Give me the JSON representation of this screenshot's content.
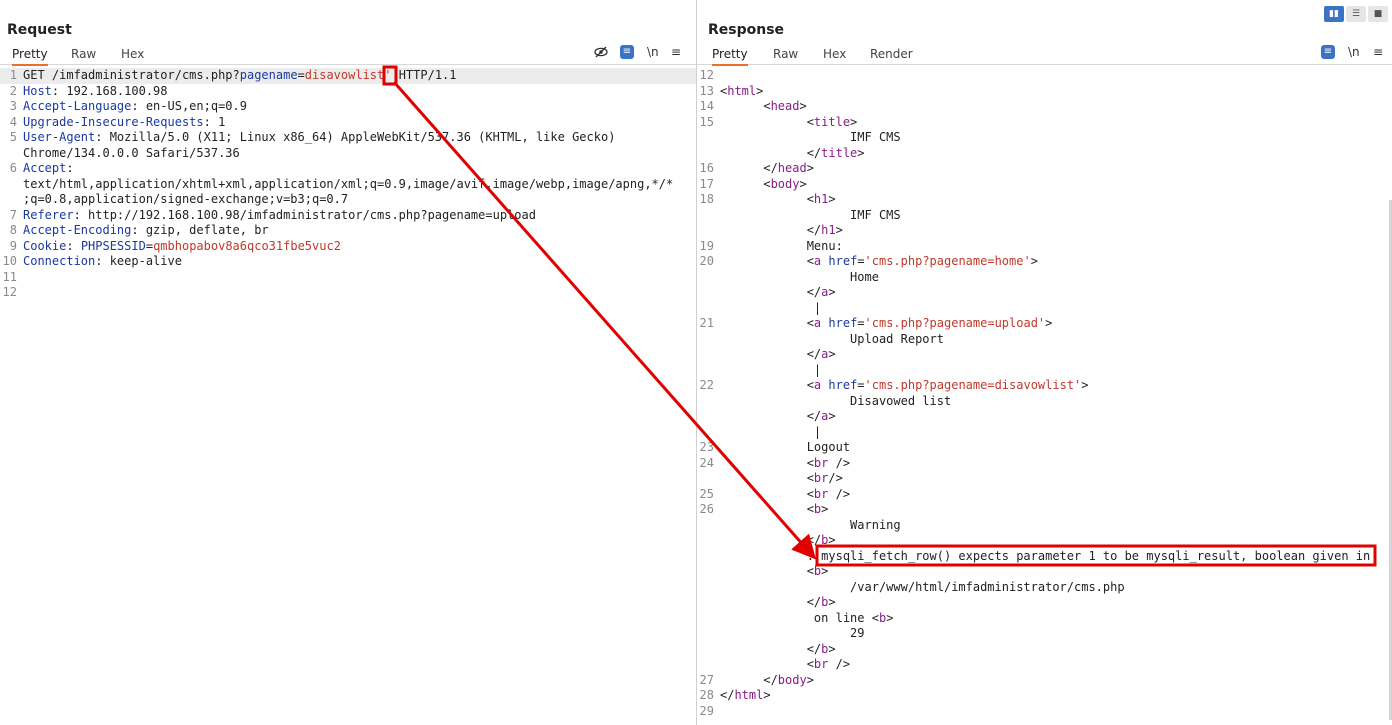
{
  "request": {
    "title": "Request",
    "tabs": [
      "Pretty",
      "Raw",
      "Hex"
    ],
    "tools": {
      "hide_icon": "eye-off-icon",
      "newline_label": "\\n",
      "menu_label": "≡"
    },
    "lines": [
      {
        "n": "1",
        "parts": [
          [
            "t",
            "GET /imfadministrator/cms.php?"
          ],
          [
            "k",
            "pagename"
          ],
          [
            "t",
            "="
          ],
          [
            "v",
            "disavowlist'"
          ],
          [
            "t",
            " HTTP/1.1"
          ]
        ],
        "hl": true
      },
      {
        "n": "2",
        "parts": [
          [
            "k",
            "Host"
          ],
          [
            "t",
            ": 192.168.100.98"
          ]
        ]
      },
      {
        "n": "3",
        "parts": [
          [
            "k",
            "Accept-Language"
          ],
          [
            "t",
            ": en-US,en;q=0.9"
          ]
        ]
      },
      {
        "n": "4",
        "parts": [
          [
            "k",
            "Upgrade-Insecure-Requests"
          ],
          [
            "t",
            ": 1"
          ]
        ]
      },
      {
        "n": "5",
        "parts": [
          [
            "k",
            "User-Agent"
          ],
          [
            "t",
            ": Mozilla/5.0 (X11; Linux x86_64) AppleWebKit/537.36 (KHTML, like Gecko)"
          ]
        ]
      },
      {
        "n": "",
        "parts": [
          [
            "t",
            "Chrome/134.0.0.0 Safari/537.36"
          ]
        ]
      },
      {
        "n": "6",
        "parts": [
          [
            "k",
            "Accept"
          ],
          [
            "t",
            ":"
          ]
        ]
      },
      {
        "n": "",
        "parts": [
          [
            "t",
            "text/html,application/xhtml+xml,application/xml;q=0.9,image/avif,image/webp,image/apng,*/*"
          ]
        ]
      },
      {
        "n": "",
        "parts": [
          [
            "t",
            ";q=0.8,application/signed-exchange;v=b3;q=0.7"
          ]
        ]
      },
      {
        "n": "7",
        "parts": [
          [
            "k",
            "Referer"
          ],
          [
            "t",
            ": http://192.168.100.98/imfadministrator/cms.php?pagename=upload"
          ]
        ]
      },
      {
        "n": "8",
        "parts": [
          [
            "k",
            "Accept-Encoding"
          ],
          [
            "t",
            ": gzip, deflate, br"
          ]
        ]
      },
      {
        "n": "9",
        "parts": [
          [
            "k",
            "Cookie"
          ],
          [
            "t",
            ": "
          ],
          [
            "k",
            "PHPSESSID"
          ],
          [
            "t",
            "="
          ],
          [
            "v",
            "qmbhopabov8a6qco31fbe5vuc2"
          ]
        ]
      },
      {
        "n": "10",
        "parts": [
          [
            "k",
            "Connection"
          ],
          [
            "t",
            ": keep-alive"
          ]
        ]
      },
      {
        "n": "11",
        "parts": []
      },
      {
        "n": "12",
        "parts": []
      }
    ]
  },
  "response": {
    "title": "Response",
    "tabs": [
      "Pretty",
      "Raw",
      "Hex",
      "Render"
    ],
    "tools": {
      "newline_label": "\\n",
      "menu_label": "≡"
    },
    "layout_icons": [
      "split-columns-icon",
      "split-rows-icon",
      "single-panel-icon"
    ],
    "lines": [
      {
        "n": "12",
        "parts": []
      },
      {
        "n": "13",
        "parts": [
          [
            "t",
            "<"
          ],
          [
            "tg",
            "html"
          ],
          [
            "t",
            ">"
          ]
        ]
      },
      {
        "n": "14",
        "parts": [
          [
            "t",
            "      <"
          ],
          [
            "tg",
            "head"
          ],
          [
            "t",
            ">"
          ]
        ]
      },
      {
        "n": "15",
        "parts": [
          [
            "t",
            "            <"
          ],
          [
            "tg",
            "title"
          ],
          [
            "t",
            ">"
          ]
        ]
      },
      {
        "n": "",
        "parts": [
          [
            "t",
            "                  IMF CMS"
          ]
        ]
      },
      {
        "n": "",
        "parts": [
          [
            "t",
            "            </"
          ],
          [
            "tg",
            "title"
          ],
          [
            "t",
            ">"
          ]
        ]
      },
      {
        "n": "16",
        "parts": [
          [
            "t",
            "      </"
          ],
          [
            "tg",
            "head"
          ],
          [
            "t",
            ">"
          ]
        ]
      },
      {
        "n": "17",
        "parts": [
          [
            "t",
            "      <"
          ],
          [
            "tg",
            "body"
          ],
          [
            "t",
            ">"
          ]
        ]
      },
      {
        "n": "18",
        "parts": [
          [
            "t",
            "            <"
          ],
          [
            "tg",
            "h1"
          ],
          [
            "t",
            ">"
          ]
        ]
      },
      {
        "n": "",
        "parts": [
          [
            "t",
            "                  IMF CMS"
          ]
        ]
      },
      {
        "n": "",
        "parts": [
          [
            "t",
            "            </"
          ],
          [
            "tg",
            "h1"
          ],
          [
            "t",
            ">"
          ]
        ]
      },
      {
        "n": "19",
        "parts": [
          [
            "t",
            "            Menu:"
          ]
        ]
      },
      {
        "n": "20",
        "parts": [
          [
            "t",
            "            <"
          ],
          [
            "tg",
            "a"
          ],
          [
            "t",
            " "
          ],
          [
            "at",
            "href"
          ],
          [
            "t",
            "="
          ],
          [
            "s",
            "'cms.php?pagename=home'"
          ],
          [
            "t",
            ">"
          ]
        ]
      },
      {
        "n": "",
        "parts": [
          [
            "t",
            "                  Home"
          ]
        ]
      },
      {
        "n": "",
        "parts": [
          [
            "t",
            "            </"
          ],
          [
            "tg",
            "a"
          ],
          [
            "t",
            ">"
          ]
        ]
      },
      {
        "n": "",
        "parts": [
          [
            "t",
            "             |"
          ]
        ]
      },
      {
        "n": "21",
        "parts": [
          [
            "t",
            "            <"
          ],
          [
            "tg",
            "a"
          ],
          [
            "t",
            " "
          ],
          [
            "at",
            "href"
          ],
          [
            "t",
            "="
          ],
          [
            "s",
            "'cms.php?pagename=upload'"
          ],
          [
            "t",
            ">"
          ]
        ]
      },
      {
        "n": "",
        "parts": [
          [
            "t",
            "                  Upload Report"
          ]
        ]
      },
      {
        "n": "",
        "parts": [
          [
            "t",
            "            </"
          ],
          [
            "tg",
            "a"
          ],
          [
            "t",
            ">"
          ]
        ]
      },
      {
        "n": "",
        "parts": [
          [
            "t",
            "             |"
          ]
        ]
      },
      {
        "n": "22",
        "parts": [
          [
            "t",
            "            <"
          ],
          [
            "tg",
            "a"
          ],
          [
            "t",
            " "
          ],
          [
            "at",
            "href"
          ],
          [
            "t",
            "="
          ],
          [
            "s",
            "'cms.php?pagename=disavowlist'"
          ],
          [
            "t",
            ">"
          ]
        ]
      },
      {
        "n": "",
        "parts": [
          [
            "t",
            "                  Disavowed list"
          ]
        ]
      },
      {
        "n": "",
        "parts": [
          [
            "t",
            "            </"
          ],
          [
            "tg",
            "a"
          ],
          [
            "t",
            ">"
          ]
        ]
      },
      {
        "n": "",
        "parts": [
          [
            "t",
            "             |"
          ]
        ]
      },
      {
        "n": "23",
        "parts": [
          [
            "t",
            "            Logout"
          ]
        ]
      },
      {
        "n": "24",
        "parts": [
          [
            "t",
            "            <"
          ],
          [
            "tg",
            "br"
          ],
          [
            "t",
            " />"
          ]
        ]
      },
      {
        "n": "",
        "parts": [
          [
            "t",
            "            <"
          ],
          [
            "tg",
            "br"
          ],
          [
            "t",
            "/>"
          ]
        ]
      },
      {
        "n": "25",
        "parts": [
          [
            "t",
            "            <"
          ],
          [
            "tg",
            "br"
          ],
          [
            "t",
            " />"
          ]
        ]
      },
      {
        "n": "26",
        "parts": [
          [
            "t",
            "            <"
          ],
          [
            "tg",
            "b"
          ],
          [
            "t",
            ">"
          ]
        ]
      },
      {
        "n": "",
        "parts": [
          [
            "t",
            "                  Warning"
          ]
        ]
      },
      {
        "n": "",
        "parts": [
          [
            "t",
            "            </"
          ],
          [
            "tg",
            "b"
          ],
          [
            "t",
            ">"
          ]
        ]
      },
      {
        "n": "",
        "parts": [
          [
            "t",
            "            : mysqli_fetch_row() expects parameter 1 to be mysqli_result, boolean given in"
          ]
        ]
      },
      {
        "n": "",
        "parts": [
          [
            "t",
            "            <"
          ],
          [
            "tg",
            "b"
          ],
          [
            "t",
            ">"
          ]
        ]
      },
      {
        "n": "",
        "parts": [
          [
            "t",
            "                  /var/www/html/imfadministrator/cms.php"
          ]
        ]
      },
      {
        "n": "",
        "parts": [
          [
            "t",
            "            </"
          ],
          [
            "tg",
            "b"
          ],
          [
            "t",
            ">"
          ]
        ]
      },
      {
        "n": "",
        "parts": [
          [
            "t",
            "             on line <"
          ],
          [
            "tg",
            "b"
          ],
          [
            "t",
            ">"
          ]
        ]
      },
      {
        "n": "",
        "parts": [
          [
            "t",
            "                  29"
          ]
        ]
      },
      {
        "n": "",
        "parts": [
          [
            "t",
            "            </"
          ],
          [
            "tg",
            "b"
          ],
          [
            "t",
            ">"
          ]
        ]
      },
      {
        "n": "",
        "parts": [
          [
            "t",
            "            <"
          ],
          [
            "tg",
            "br"
          ],
          [
            "t",
            " />"
          ]
        ]
      },
      {
        "n": "27",
        "parts": [
          [
            "t",
            "      </"
          ],
          [
            "tg",
            "body"
          ],
          [
            "t",
            ">"
          ]
        ]
      },
      {
        "n": "28",
        "parts": [
          [
            "t",
            "</"
          ],
          [
            "tg",
            "html"
          ],
          [
            "t",
            ">"
          ]
        ]
      },
      {
        "n": "29",
        "parts": []
      }
    ]
  },
  "annotation": {
    "color": "#e00000"
  }
}
